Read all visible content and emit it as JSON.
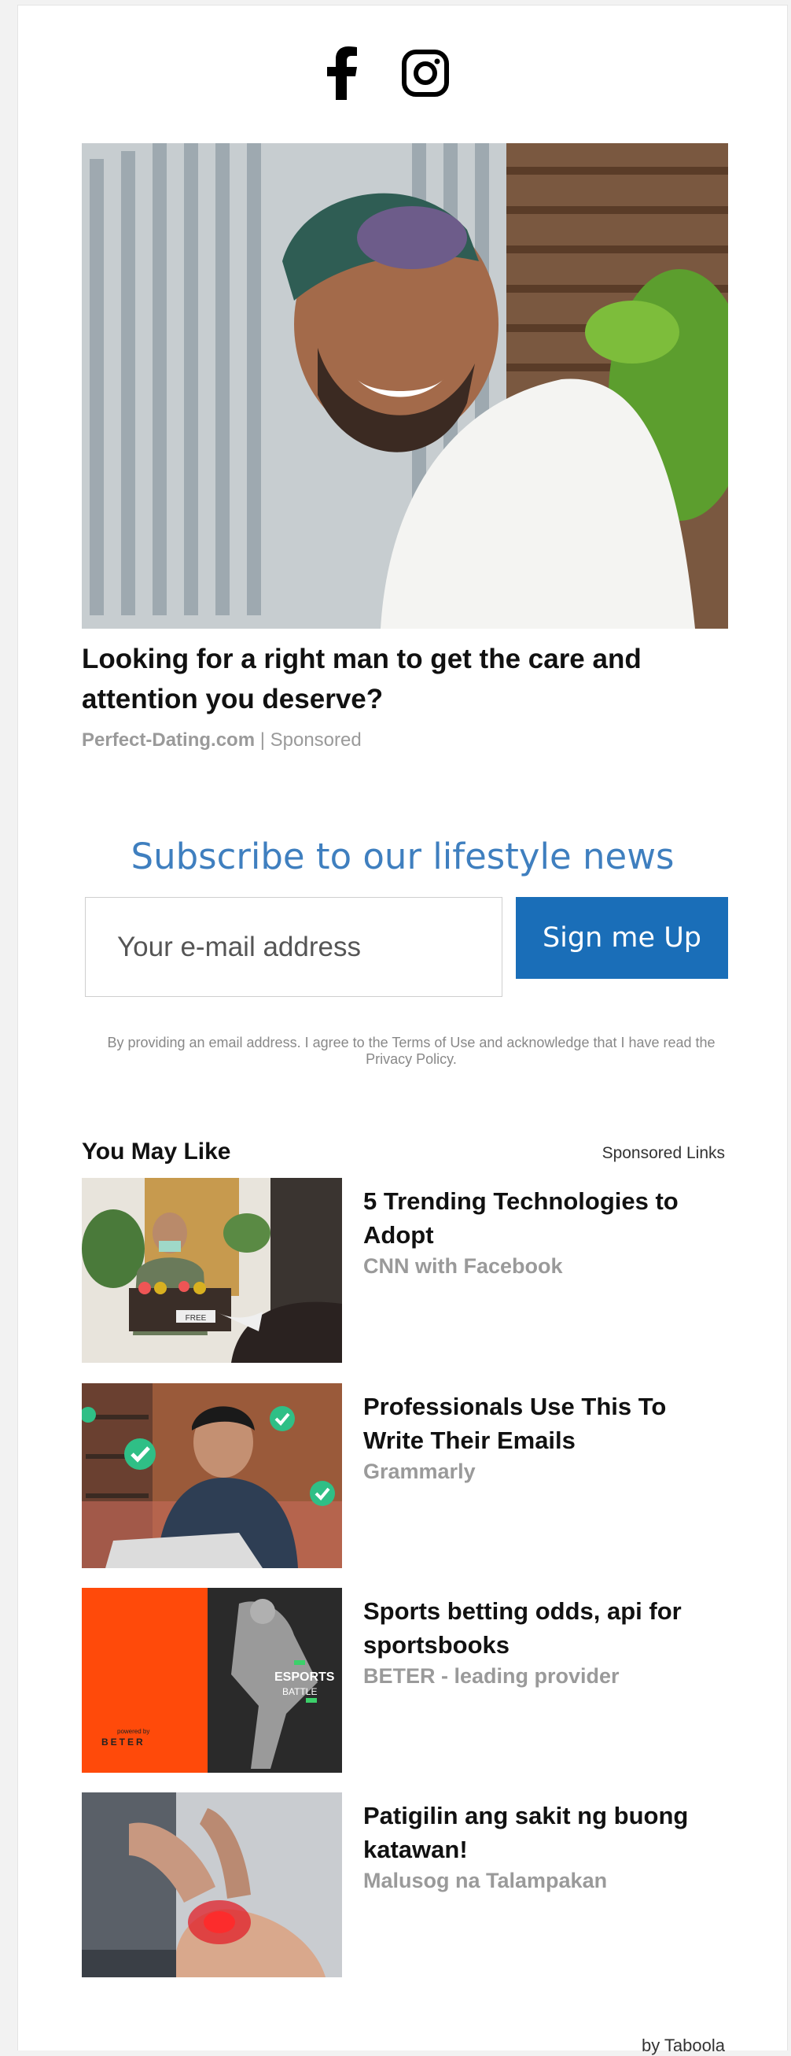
{
  "social": {
    "facebook_icon": "facebook-icon",
    "instagram_icon": "instagram-icon"
  },
  "hero": {
    "title": "Looking for a right man to get the care and attention you deserve?",
    "source": "Perfect-Dating.com",
    "separator": " | ",
    "sponsored": "Sponsored"
  },
  "subscribe": {
    "title": "Subscribe to our lifestyle news",
    "email_placeholder": "Your e-mail address",
    "button_label": "Sign me Up",
    "disclaimer": "By providing an email address. I agree to the Terms of Use and acknowledge that I have read the Privacy Policy."
  },
  "recommendations": {
    "title": "You May Like",
    "sponsored_links": "Sponsored Links",
    "items": [
      {
        "title": "5 Trending Technologies to Adopt",
        "source": "CNN with Facebook"
      },
      {
        "title": "Professionals Use This To Write Their Emails",
        "source": "Grammarly"
      },
      {
        "title": "Sports betting odds, api for sportsbooks",
        "source": "BETER - leading provider"
      },
      {
        "title": "Patigilin ang sakit ng buong katawan!",
        "source": "Malusog na Talampakan"
      }
    ],
    "thumb_texts": {
      "box_label": "FREE",
      "esports": "ESPORTS",
      "battle": "BATTLE",
      "powered_by": "powered by",
      "beter": "BETER"
    },
    "footer": "by Taboola"
  },
  "colors": {
    "accent_blue": "#3f7fbf",
    "button_blue": "#1a6eb8",
    "muted_gray": "#9a9a9a",
    "beter_orange": "#ff4a0a"
  }
}
